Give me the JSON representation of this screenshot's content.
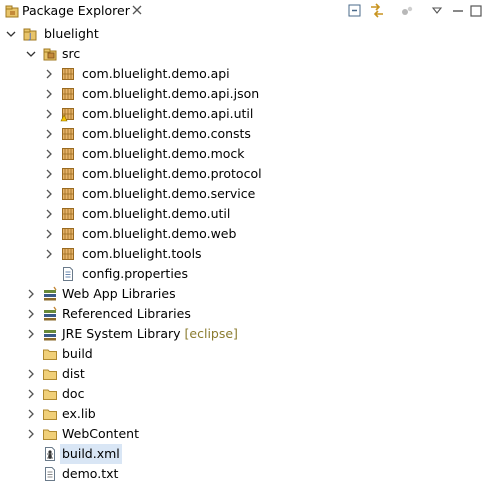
{
  "view": {
    "title": "Package Explorer",
    "close_tooltip": "Close",
    "toolbar": [
      "collapse-all-icon",
      "link-with-editor-icon",
      "focus-icon",
      "view-menu-icon",
      "minimize-icon",
      "maximize-icon"
    ]
  },
  "tree": {
    "project": "bluelight",
    "source_folder": "src",
    "packages": [
      "com.bluelight.demo.api",
      "com.bluelight.demo.api.json",
      "com.bluelight.demo.api.util",
      "com.bluelight.demo.consts",
      "com.bluelight.demo.mock",
      "com.bluelight.demo.protocol",
      "com.bluelight.demo.service",
      "com.bluelight.demo.util",
      "com.bluelight.demo.web",
      "com.bluelight.tools"
    ],
    "src_file": "config.properties",
    "libraries": [
      {
        "label": "Web App Libraries"
      },
      {
        "label": "Referenced Libraries"
      },
      {
        "label": "JRE System Library",
        "decoration": "[eclipse]"
      }
    ],
    "folders": [
      "build",
      "dist",
      "doc",
      "ex.lib",
      "WebContent"
    ],
    "files": [
      "build.xml",
      "demo.txt"
    ]
  },
  "colors": {
    "package_icon": "#c48a3a",
    "folder_icon": "#e8c46a",
    "selection": "#d9e6f5",
    "decoration": "#8a7b2e"
  }
}
